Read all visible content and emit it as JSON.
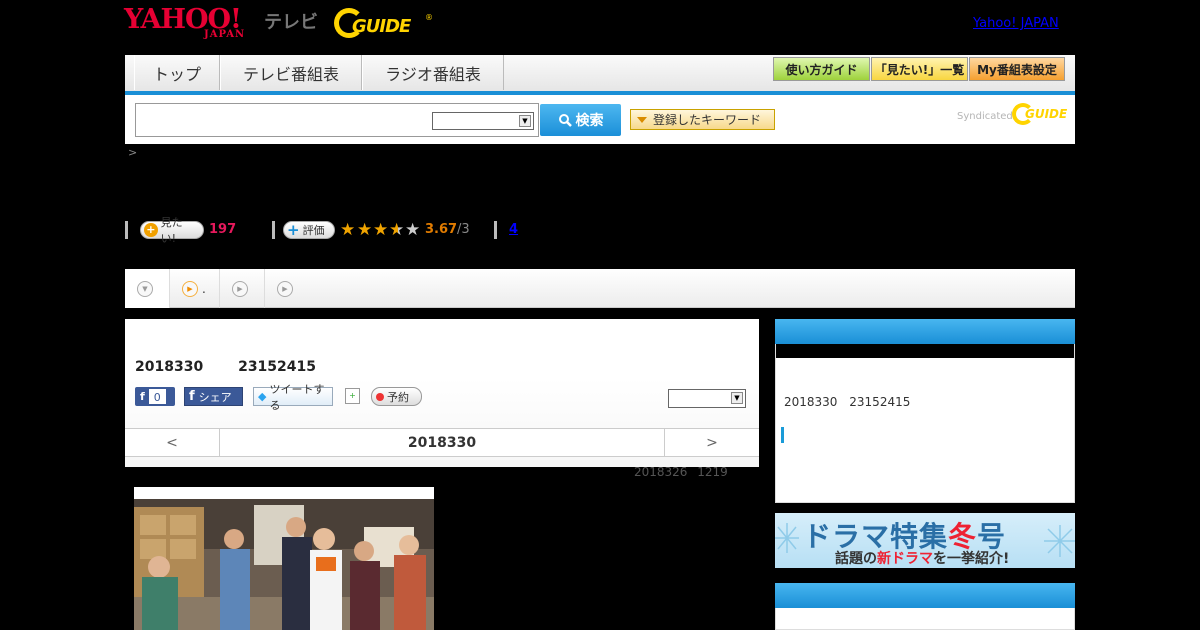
{
  "header": {
    "brand_yahoo": "YAHOO!",
    "brand_japan": "JAPAN",
    "brand_tv": "テレビ",
    "brand_guide": "GUIDE",
    "brand_reg": "®",
    "top_link": "Yahoo! JAPAN"
  },
  "nav": {
    "tabs": [
      "トップ",
      "テレビ番組表",
      "ラジオ番組表"
    ],
    "buttons": [
      "使い方ガイド",
      "「見たい!」一覧",
      "My番組表設定"
    ]
  },
  "search": {
    "query": "",
    "genre_selected": "",
    "submit_label": "検索",
    "keyword_button": "登録したキーワード",
    "syndicated_label": "Syndicated",
    "syndicated_guide": "GUIDE"
  },
  "breadcrumb": ">",
  "rating": {
    "mitai_label": "見たい!",
    "mitai_count": "197",
    "evaluate_label": "評価",
    "stars": 3.67,
    "score": "3.67",
    "score_suffix": "/3",
    "reviews_link": "4"
  },
  "tabs_strip": {
    "tab2_label": "."
  },
  "program": {
    "air_date": "2018330",
    "air_time": "23152415",
    "fb_like_count": "0",
    "fb_share_label": "シェア",
    "tweet_label": "ツイートする",
    "reserve_label": "予約",
    "channel_selected": "",
    "prev_label": "<",
    "next_label": ">",
    "current_date": "2018330",
    "update_date": "2018326",
    "update_time": "1219"
  },
  "sidebar": {
    "info_date": "2018330",
    "info_time": "23152415",
    "banner_line1_a": "ドラマ特集",
    "banner_line1_b": "冬",
    "banner_line1_c": "号",
    "banner_line2_a": "話題の",
    "banner_line2_b": "新ドラマ",
    "banner_line2_c": "を一挙紹介!"
  },
  "colors": {
    "brand_red": "#e60033",
    "accent_blue": "#1a8fd6",
    "guide_yellow": "#ffd400",
    "count_pink": "#e6195c",
    "star_orange": "#f0a400"
  }
}
